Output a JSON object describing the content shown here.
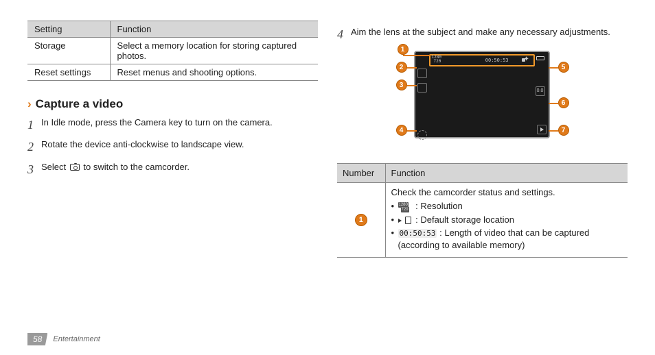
{
  "left_table": {
    "head": {
      "c1": "Setting",
      "c2": "Function"
    },
    "rows": [
      {
        "c1": "Storage",
        "c2": "Select a memory location for storing captured photos."
      },
      {
        "c1": "Reset settings",
        "c2": "Reset menus and shooting options."
      }
    ]
  },
  "section_title": "Capture a video",
  "steps": {
    "s1": "In Idle mode, press the Camera key to turn on the camera.",
    "s2": "Rotate the device anti-clockwise to landscape view.",
    "s3_a": "Select",
    "s3_b": "to switch to the camcorder.",
    "s4": "Aim the lens at the subject and make any necessary adjustments."
  },
  "step_nums": {
    "n1": "1",
    "n2": "2",
    "n3": "3",
    "n4": "4"
  },
  "preview": {
    "timer": "00:50:53",
    "res_top": "1280",
    "res_bot": "720",
    "ev": "0.0"
  },
  "callouts": {
    "c1": "1",
    "c2": "2",
    "c3": "3",
    "c4": "4",
    "c5": "5",
    "c6": "6",
    "c7": "7"
  },
  "nf_table": {
    "head": {
      "c1": "Number",
      "c2": "Function"
    },
    "row1": {
      "num": "1",
      "intro": "Check the camcorder status and settings.",
      "b1": ": Resolution",
      "b2": ": Default storage location",
      "b3_code": "00:50:53",
      "b3_rest": ": Length of video that can be captured (according to available memory)"
    }
  },
  "footer": {
    "page": "58",
    "chapter": "Entertainment"
  }
}
